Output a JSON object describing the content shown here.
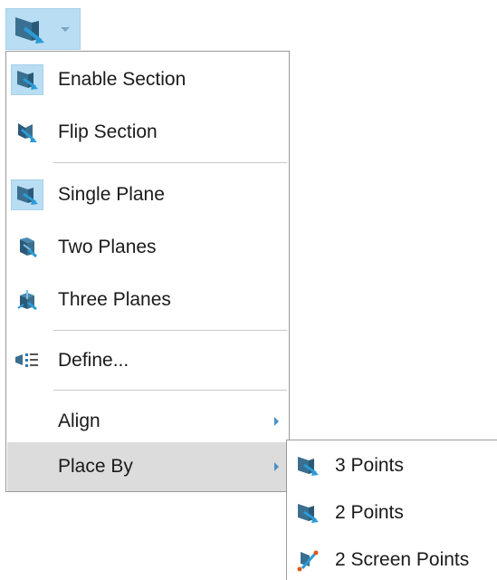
{
  "toolbar": {
    "section_button_icon": "section-plane-icon",
    "dropdown_icon": "chevron-down-icon"
  },
  "menu": {
    "items": [
      {
        "label": "Enable Section",
        "icon": "section-plane-icon",
        "checked": true
      },
      {
        "label": "Flip Section",
        "icon": "flip-section-icon",
        "checked": false
      },
      {
        "label": "Single Plane",
        "icon": "single-plane-icon",
        "checked": true
      },
      {
        "label": "Two Planes",
        "icon": "two-planes-icon",
        "checked": false
      },
      {
        "label": "Three Planes",
        "icon": "three-planes-icon",
        "checked": false
      },
      {
        "label": "Define...",
        "icon": "define-icon",
        "checked": false
      },
      {
        "label": "Align",
        "icon": "",
        "has_submenu": true
      },
      {
        "label": "Place By",
        "icon": "",
        "has_submenu": true,
        "highlighted": true
      }
    ]
  },
  "submenu": {
    "items": [
      {
        "label": "3 Points",
        "icon": "three-points-icon"
      },
      {
        "label": "2 Points",
        "icon": "two-points-icon"
      },
      {
        "label": "2 Screen Points",
        "icon": "screen-points-icon"
      }
    ]
  },
  "colors": {
    "accent": "#2a7ab0",
    "checked_bg": "#b9ddf3",
    "highlight_bg": "#dcdcdc"
  }
}
